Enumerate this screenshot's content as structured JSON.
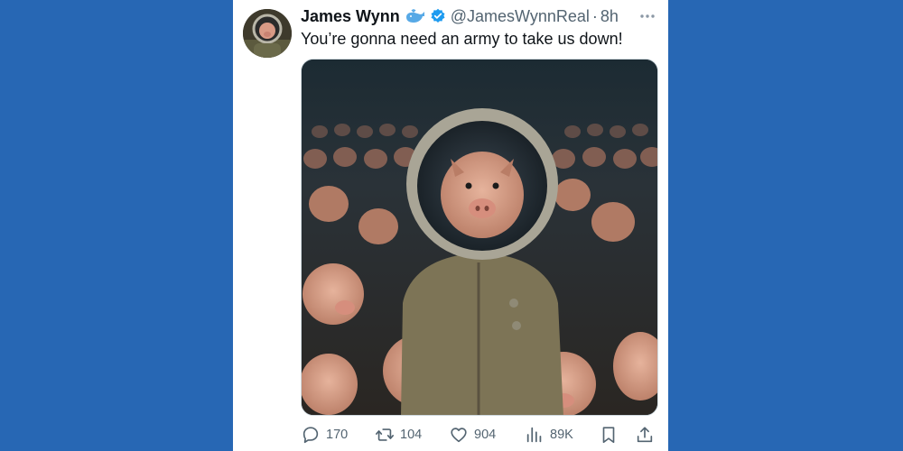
{
  "tweet": {
    "display_name": "James Wynn",
    "handle": "@JamesWynnReal",
    "separator": "·",
    "time": "8h",
    "text": "You’re gonna need an army to take us down!",
    "badges": [
      "whale-icon",
      "verified-badge-icon"
    ]
  },
  "actions": {
    "replies": "170",
    "retweets": "104",
    "likes": "904",
    "views": "89K"
  },
  "colors": {
    "background": "#2767b4",
    "card": "#ffffff",
    "text": "#0f1419",
    "muted": "#536471",
    "verified": "#1d9bf0"
  },
  "icons": [
    "reply-icon",
    "retweet-icon",
    "like-icon",
    "views-icon",
    "bookmark-icon",
    "share-icon",
    "more-icon"
  ]
}
